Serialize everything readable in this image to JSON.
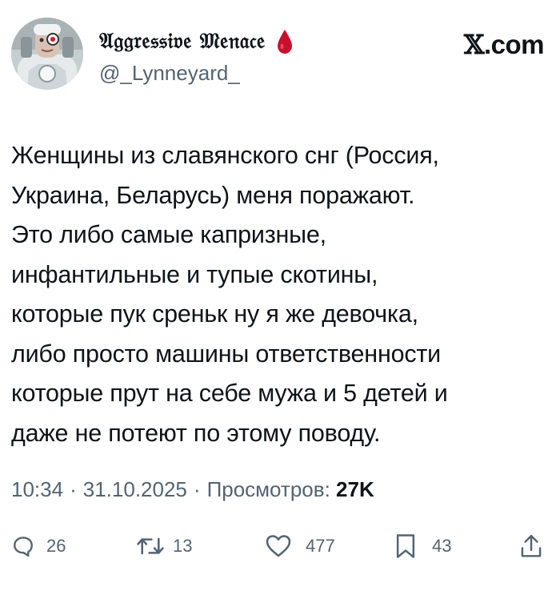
{
  "author": {
    "display_name": "𝔄𝔤𝔤𝔯𝔢𝔰𝔰𝔦𝔳𝔢 𝔐𝔢𝔫𝔞𝔠𝔢",
    "handle": "@_Lynneyard_",
    "avatar_icon": "cyborg-avatar",
    "emoji": "blood-drop-icon",
    "emoji_color": "#c8102e"
  },
  "site": {
    "x_glyph": "𝕏",
    "domain": ".com"
  },
  "tweet": {
    "lines": [
      "Женщины из славянского снг (Россия,",
      "Украина, Беларусь) меня поражают.",
      "Это либо самые капризные,",
      "инфантильные и тупые скотины,",
      "которые пук среньк ну я же девочка,",
      "либо просто машины ответственности",
      "которые прут на себе мужа и 5 детей и",
      "даже не потеют по этому поводу."
    ]
  },
  "meta": {
    "time": "10:34",
    "separator": "·",
    "date": "31.10.2025",
    "views_label": "Просмотров:",
    "views_count": "27K"
  },
  "actions": {
    "replies": "26",
    "reposts": "13",
    "likes": "477",
    "bookmarks": "43"
  },
  "colors": {
    "text": "#0f1419",
    "secondary": "#536471"
  }
}
